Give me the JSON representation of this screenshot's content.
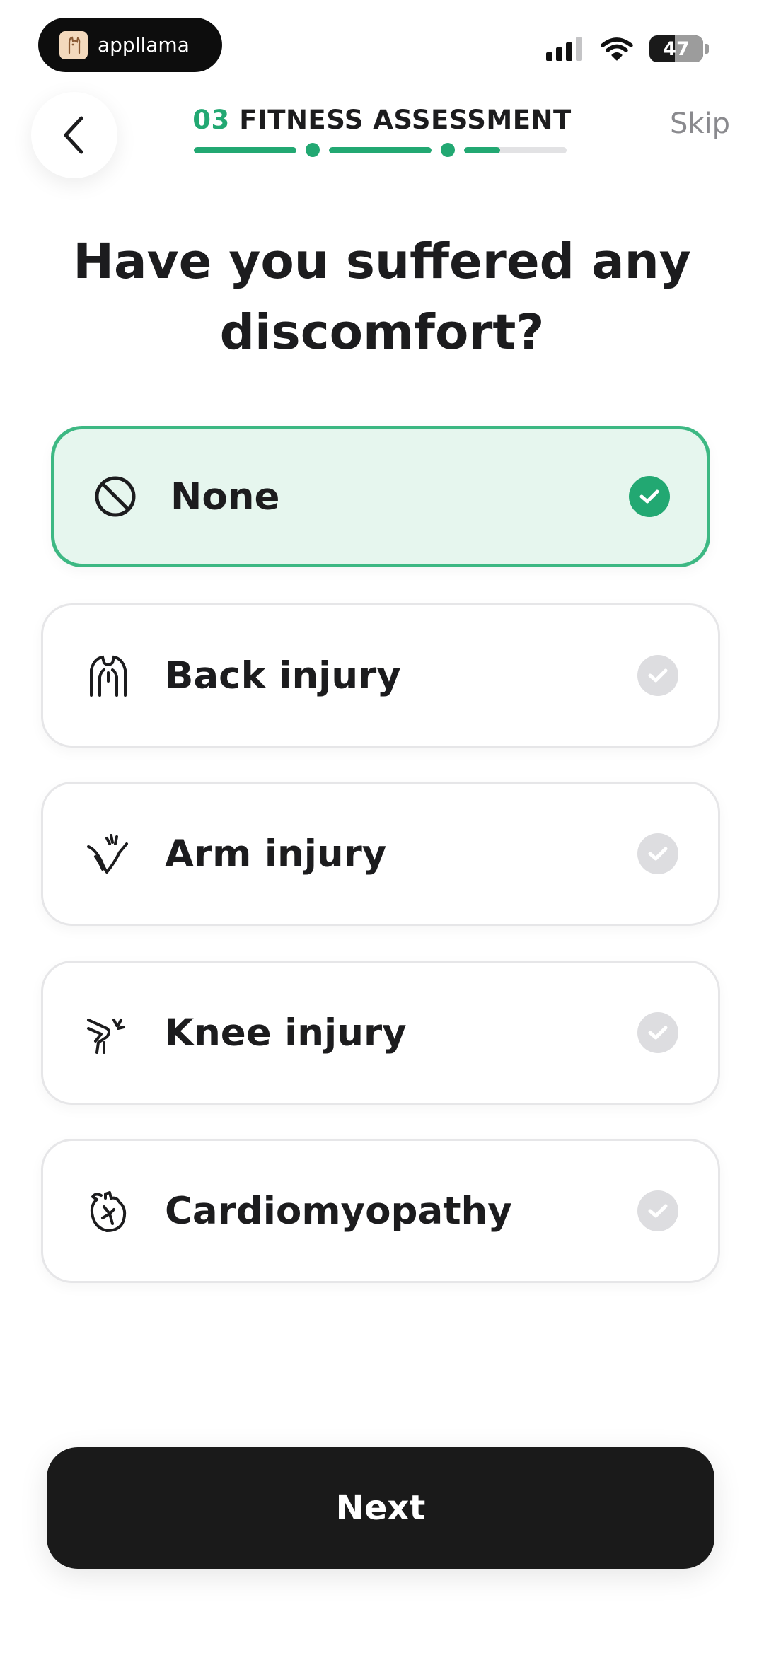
{
  "status_bar": {
    "app_name": "appllama",
    "battery_level": "47",
    "battery_fraction": 0.47
  },
  "header": {
    "step_number": "03",
    "step_title": "FITNESS ASSESSMENT",
    "skip_label": "Skip",
    "progress": [
      1,
      1,
      0.35
    ]
  },
  "question": "Have you suffered any discomfort?",
  "options": [
    {
      "label": "None",
      "icon": "none-icon",
      "selected": true
    },
    {
      "label": "Back injury",
      "icon": "back-icon",
      "selected": false
    },
    {
      "label": "Arm injury",
      "icon": "arm-icon",
      "selected": false
    },
    {
      "label": "Knee injury",
      "icon": "knee-icon",
      "selected": false
    },
    {
      "label": "Cardiomyopathy",
      "icon": "heart-icon",
      "selected": false
    }
  ],
  "next_label": "Next",
  "colors": {
    "accent": "#22a872",
    "selected_bg": "#e6f6ee",
    "button_bg": "#1a1a1a"
  }
}
